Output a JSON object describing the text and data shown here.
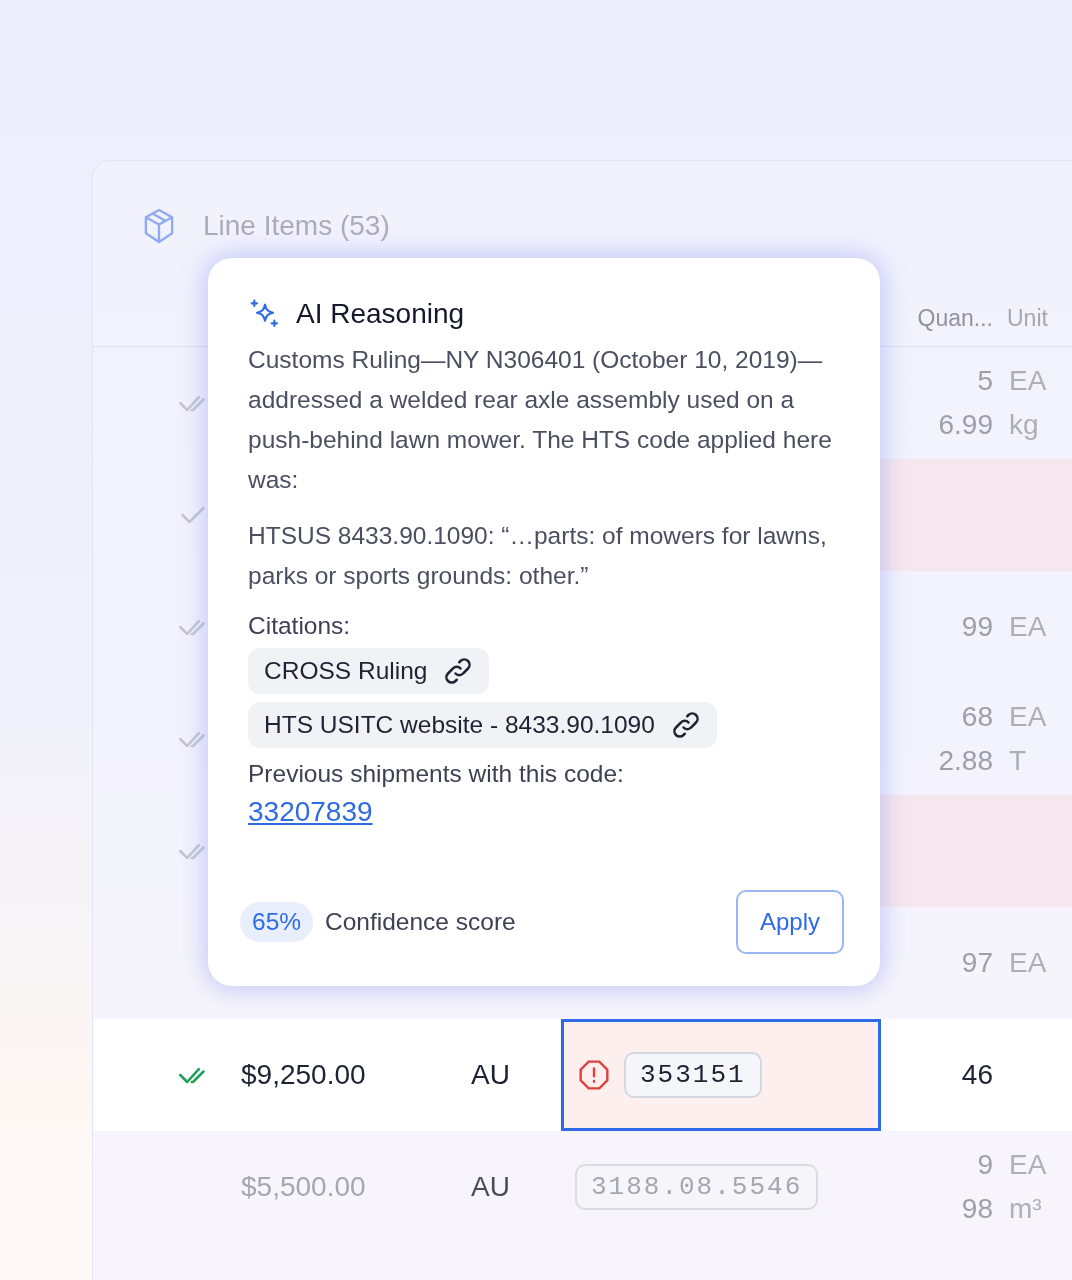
{
  "card": {
    "title": "Line Items (53)",
    "columns": [
      {
        "label": "Quan..."
      },
      {
        "label": "Unit"
      }
    ],
    "rows": [
      {
        "selected": false,
        "kind": "double",
        "flagged": false,
        "quantities": [
          {
            "value": "5",
            "unit": "EA"
          },
          {
            "value": "6.99",
            "unit": "kg"
          }
        ]
      },
      {
        "selected": false,
        "kind": "single",
        "flagged": true,
        "quantities": []
      },
      {
        "selected": false,
        "kind": "double",
        "flagged": false,
        "quantities": [
          {
            "value": "99",
            "unit": "EA"
          }
        ]
      },
      {
        "selected": false,
        "kind": "double",
        "flagged": false,
        "quantities": [
          {
            "value": "68",
            "unit": "EA"
          },
          {
            "value": "2.88",
            "unit": "T"
          }
        ]
      },
      {
        "selected": false,
        "kind": "double",
        "flagged": true,
        "quantities": []
      },
      {
        "selected": false,
        "kind": "none",
        "flagged": false,
        "quantities": [
          {
            "value": "97",
            "unit": "EA"
          }
        ]
      },
      {
        "selected": true,
        "kind": "double",
        "flagged": false,
        "amount": "$9,250.00",
        "country": "AU",
        "code": "353151",
        "code_error": true,
        "quantities": [
          {
            "value": "46"
          }
        ]
      },
      {
        "selected": false,
        "kind": "none",
        "flagged": false,
        "amount": "$5,500.00",
        "country": "AU",
        "code": "3188.08.5546",
        "code_error": false,
        "quantities": [
          {
            "value": "9",
            "unit": "EA"
          },
          {
            "value": "98",
            "unit": "m³"
          }
        ]
      }
    ]
  },
  "popover": {
    "title": "AI Reasoning",
    "paragraphs": [
      "Customs Ruling—NY N306401 (October 10, 2019)—addressed a welded rear axle assembly used on a push-behind lawn mower. The HTS code applied here was:",
      "HTSUS 8433.90.1090: “…parts: of mowers for lawns, parks or sports grounds: other.”"
    ],
    "citations_label": "Citations:",
    "citations": [
      "CROSS Ruling",
      "HTS USITC website - 8433.90.1090"
    ],
    "shipments_label": "Previous shipments with this code:",
    "shipment_link": "33207839",
    "confidence": "65%",
    "confidence_label": "Confidence score",
    "apply": "Apply"
  }
}
